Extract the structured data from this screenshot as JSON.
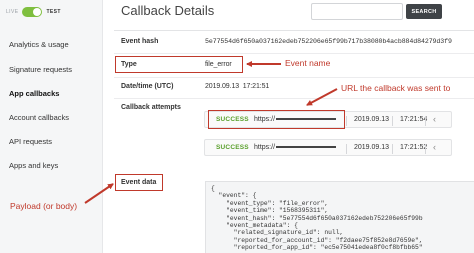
{
  "env": {
    "live_label": "LIVE",
    "test_label": "TEST"
  },
  "sidebar": {
    "items": [
      {
        "label": "Analytics & usage"
      },
      {
        "label": "Signature requests"
      },
      {
        "label": "App callbacks"
      },
      {
        "label": "Account callbacks"
      },
      {
        "label": "API requests"
      },
      {
        "label": "Apps and keys"
      }
    ],
    "active_item": "App callbacks"
  },
  "header": {
    "title": "Callback Details",
    "search_placeholder": "",
    "search_button": "SEARCH"
  },
  "details": {
    "event_hash": {
      "label": "Event hash",
      "value": "5e77554d6f650a037162edeb752206e65f99b717b38080b4acb884d84279d3f9"
    },
    "type": {
      "label": "Type",
      "value": "file_error"
    },
    "datetime": {
      "label": "Date/time (UTC)",
      "value": "2019.09.13  17:21:51"
    },
    "attempts_label": "Callback attempts",
    "event_data_label": "Event data"
  },
  "attempts": [
    {
      "status": "SUCCESS",
      "url_prefix": "https://",
      "date": "2019.09.13",
      "time": "17:21:54",
      "chevron": "‹"
    },
    {
      "status": "SUCCESS",
      "url_prefix": "https://",
      "date": "2019.09.13",
      "time": "17:21:52",
      "chevron": "‹"
    }
  ],
  "payload": {
    "lines": [
      "{",
      "  \"event\": {",
      "    \"event_type\": \"file_error\",",
      "    \"event_time\": \"1568395311\",",
      "    \"event_hash\": \"5e77554d6f650a037162edeb752206e65f99b",
      "    \"event_metadata\": {",
      "      \"related_signature_id\": null,",
      "      \"reported_for_account_id\": \"f2daee75f852e8d7659e\",",
      "      \"reported_for_app_id\": \"ec5e75041edea8f0cf8bfbb65\""
    ]
  },
  "annotations": {
    "event_name": "Event name",
    "url": "URL the callback was sent to",
    "payload": "Payload (or body)",
    "color": "#c0392b"
  },
  "colors": {
    "success": "#5aa02c",
    "toggle_on": "#7fbf3f",
    "search_button": "#3f4347"
  }
}
